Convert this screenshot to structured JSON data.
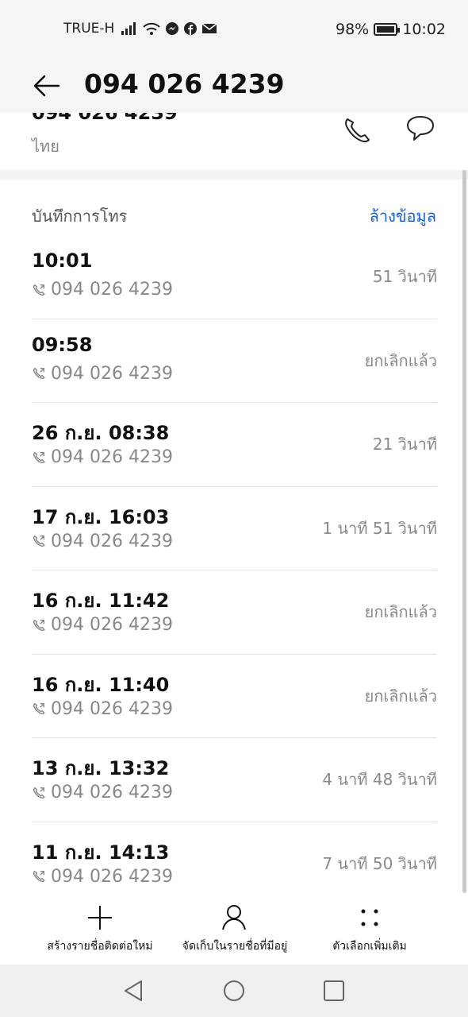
{
  "status_bar": {
    "carrier": "TRUE-H",
    "battery": "98%",
    "battery_level": 0.98,
    "time": "10:02"
  },
  "header": {
    "title": "094 026 4239"
  },
  "contact": {
    "number_partial": "094 026 4239",
    "country": "ไทย"
  },
  "call_log": {
    "title": "บันทึกการโทร",
    "clear_label": "ล้างข้อมูล",
    "entries": [
      {
        "time": "10:01",
        "number": "094 026 4239",
        "duration": "51 วินาที"
      },
      {
        "time": "09:58",
        "number": "094 026 4239",
        "duration": "ยกเลิกแล้ว"
      },
      {
        "time": "26 ก.ย. 08:38",
        "number": "094 026 4239",
        "duration": "21 วินาที"
      },
      {
        "time": "17 ก.ย. 16:03",
        "number": "094 026 4239",
        "duration": "1 นาที 51 วินาที"
      },
      {
        "time": "16 ก.ย. 11:42",
        "number": "094 026 4239",
        "duration": "ยกเลิกแล้ว"
      },
      {
        "time": "16 ก.ย. 11:40",
        "number": "094 026 4239",
        "duration": "ยกเลิกแล้ว"
      },
      {
        "time": "13 ก.ย. 13:32",
        "number": "094 026 4239",
        "duration": "4 นาที 48 วินาที"
      },
      {
        "time": "11 ก.ย. 14:13",
        "number": "094 026 4239",
        "duration": "7 นาที 50 วินาที"
      }
    ]
  },
  "actions": {
    "new_contact": "สร้างรายชื่อติดต่อใหม่",
    "save_existing": "จัดเก็บในรายชื่อที่มีอยู่",
    "more": "ตัวเลือกเพิ่มเติม"
  },
  "colors": {
    "accent": "#1a5fd0",
    "secondary_text": "#888888"
  }
}
